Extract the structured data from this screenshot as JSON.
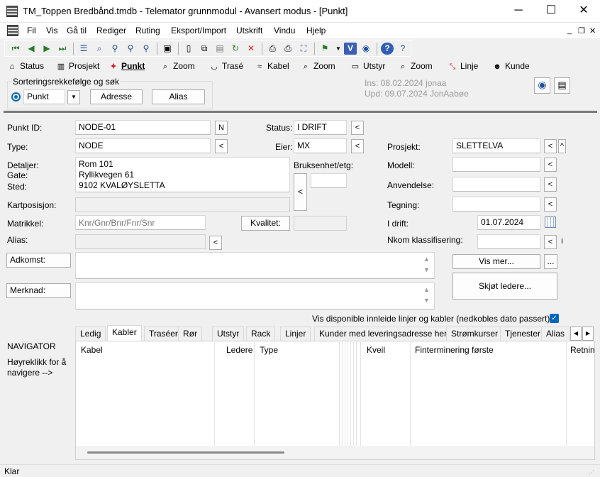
{
  "window": {
    "title": "TM_Toppen Bredbånd.tmdb - Telemator grunnmodul - Avansert modus - [Punkt]",
    "minimize": "─",
    "maximize": "☐",
    "close": "✕"
  },
  "menu": {
    "items": [
      "Fil",
      "Vis",
      "Gå til",
      "Rediger",
      "Ruting",
      "Eksport/Import",
      "Utskrift",
      "Vindu",
      "Hjelp"
    ],
    "mdi_minimize": "_",
    "mdi_restore": "❐",
    "mdi_close": "✕"
  },
  "module_tabs": [
    {
      "label": "Status",
      "icon": "house-icon",
      "glyph": "⌂"
    },
    {
      "label": "Prosjekt",
      "icon": "project-icon",
      "glyph": "▥"
    },
    {
      "label": "Punkt",
      "icon": "point-icon",
      "glyph": "✦"
    },
    {
      "label": "Zoom",
      "icon": "zoom-icon",
      "glyph": "⌕"
    },
    {
      "label": "Trasé",
      "icon": "route-icon",
      "glyph": "◡"
    },
    {
      "label": "Kabel",
      "icon": "cable-icon",
      "glyph": "≈"
    },
    {
      "label": "Zoom",
      "icon": "zoom-icon",
      "glyph": "⌕"
    },
    {
      "label": "Utstyr",
      "icon": "equipment-icon",
      "glyph": "▭"
    },
    {
      "label": "Zoom",
      "icon": "zoom-icon",
      "glyph": "⌕"
    },
    {
      "label": "Linje",
      "icon": "line-icon",
      "glyph": "⤡"
    },
    {
      "label": "Kunde",
      "icon": "customer-icon",
      "glyph": "☻"
    }
  ],
  "sort": {
    "group_label": "Sorteringsrekkefølge og søk",
    "selected": "Punkt",
    "address_button": "Adresse",
    "alias_button": "Alias"
  },
  "audit": {
    "ins": "Ins: 08.02.2024 jonaa",
    "upd": "Upd: 09.07.2024 JonAabøe"
  },
  "form": {
    "punkt_id_label": "Punkt ID:",
    "punkt_id_value": "NODE-01",
    "n_button": "N",
    "type_label": "Type:",
    "type_value": "NODE",
    "status_label": "Status:",
    "status_value": "I DRIFT",
    "eier_label": "Eier:",
    "eier_value": "MX",
    "detaljer_label": "Detaljer:",
    "gate_label": "Gate:",
    "sted_label": "Sted:",
    "address_lines": [
      "Rom 101",
      "Ryllikvegen 61",
      "9102 KVALØYSLETTA"
    ],
    "bruksenhet_label": "Bruksenhet/etg:",
    "kartposisjon_label": "Kartposisjon:",
    "matrikkel_label": "Matrikkel:",
    "matrikkel_placeholder": "Knr/Gnr/Bnr/Fnr/Snr",
    "kvalitet_button": "Kvalitet:",
    "alias_label": "Alias:",
    "adkomst_button": "Adkomst:",
    "merknad_button": "Merknad:",
    "prosjekt_label": "Prosjekt:",
    "prosjekt_value": "SLETTELVA",
    "modell_label": "Modell:",
    "anvendelse_label": "Anvendelse:",
    "tegning_label": "Tegning:",
    "idrift_label": "I drift:",
    "idrift_value": "01.07.2024",
    "nkom_label": "Nkom klassifisering:",
    "vis_mer_button": "Vis mer...",
    "dots_button": "...",
    "skjot_button": "Skjøt ledere...",
    "i_button": "i",
    "caret_up_button": "^",
    "arrow_button": "<",
    "vis_disponible": "Vis disponible innleide linjer og kabler (nedkobles dato passert)"
  },
  "navigator": {
    "title": "NAVIGATOR",
    "hint": "Høyreklikk for å navigere -->"
  },
  "bottom_tabs": [
    "Ledig",
    "Kabler",
    "Traséer",
    "Rør",
    "Utstyr",
    "Rack",
    "Linjer",
    "Kunder med leveringsadresse her",
    "Strømkurser",
    "Tjenester",
    "Alias"
  ],
  "active_bottom_tab": "Kabler",
  "grid": {
    "columns": [
      "Kabel",
      "Ledere",
      "Type",
      "Kveil",
      "Finterminering første",
      "Retnin"
    ]
  },
  "statusbar": {
    "text": "Klar"
  },
  "colors": {
    "accent": "#0067c0",
    "separator": "#7a7a7a"
  }
}
